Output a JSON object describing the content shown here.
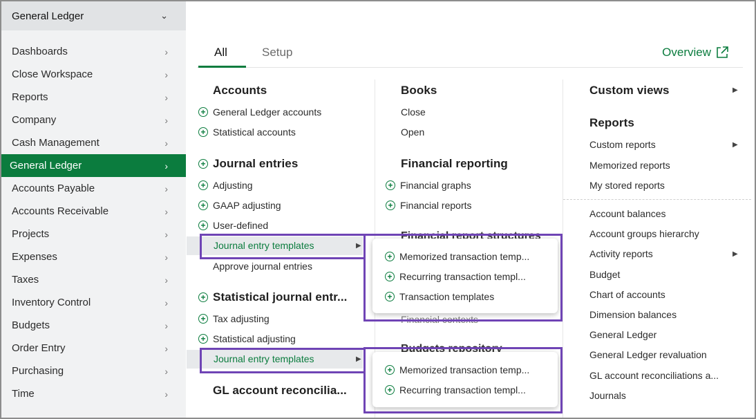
{
  "sidebar": {
    "header": "General Ledger",
    "items": [
      {
        "label": "Dashboards"
      },
      {
        "label": "Close Workspace"
      },
      {
        "label": "Reports"
      },
      {
        "label": "Company"
      },
      {
        "label": "Cash Management"
      },
      {
        "label": "General Ledger",
        "active": true
      },
      {
        "label": "Accounts Payable"
      },
      {
        "label": "Accounts Receivable"
      },
      {
        "label": "Projects"
      },
      {
        "label": "Expenses"
      },
      {
        "label": "Taxes"
      },
      {
        "label": "Inventory Control"
      },
      {
        "label": "Budgets"
      },
      {
        "label": "Order Entry"
      },
      {
        "label": "Purchasing"
      },
      {
        "label": "Time"
      }
    ]
  },
  "tabs": {
    "all": "All",
    "setup": "Setup",
    "overview": "Overview"
  },
  "col1": {
    "accounts_title": "Accounts",
    "accounts": [
      "General Ledger accounts",
      "Statistical accounts"
    ],
    "journal_title": "Journal entries",
    "journal": [
      "Adjusting",
      "GAAP adjusting",
      "User-defined"
    ],
    "journal_templates": "Journal entry templates",
    "approve": "Approve journal entries",
    "stat_title": "Statistical journal entr...",
    "stat": [
      "Tax adjusting",
      "Statistical adjusting"
    ],
    "stat_templates": "Journal entry templates",
    "recon_title": "GL account reconcilia..."
  },
  "col2": {
    "books_title": "Books",
    "books": [
      "Close",
      "Open"
    ],
    "fin_title": "Financial reporting",
    "fin": [
      "Financial graphs",
      "Financial reports"
    ],
    "ghost1": "Financial report structures",
    "ghost2": "Financial contexts",
    "ghost3": "Budgets repository"
  },
  "popup1": [
    "Memorized transaction temp...",
    "Recurring transaction templ...",
    "Transaction templates"
  ],
  "popup2": [
    "Memorized transaction temp...",
    "Recurring transaction templ..."
  ],
  "col3": {
    "custom_views": "Custom views",
    "reports_title": "Reports",
    "custom_reports": "Custom reports",
    "memorized_reports": "Memorized reports",
    "my_stored_reports": "My stored reports",
    "account_balances": "Account balances",
    "account_groups_hierarchy": "Account groups hierarchy",
    "activity_reports": "Activity reports",
    "budget": "Budget",
    "chart_of_accounts": "Chart of accounts",
    "dimension_balances": "Dimension balances",
    "general_ledger": "General Ledger",
    "gl_revaluation": "General Ledger revaluation",
    "gl_recon": "GL account reconciliations a...",
    "journals": "Journals"
  },
  "colors": {
    "accent": "#0b7c3e",
    "highlight": "#6f44b5",
    "sidebar_bg": "#f1f2f3"
  },
  "icons": {
    "chevron": "chevron-right-icon",
    "plus": "plus-circle-icon",
    "external": "external-link-icon"
  }
}
